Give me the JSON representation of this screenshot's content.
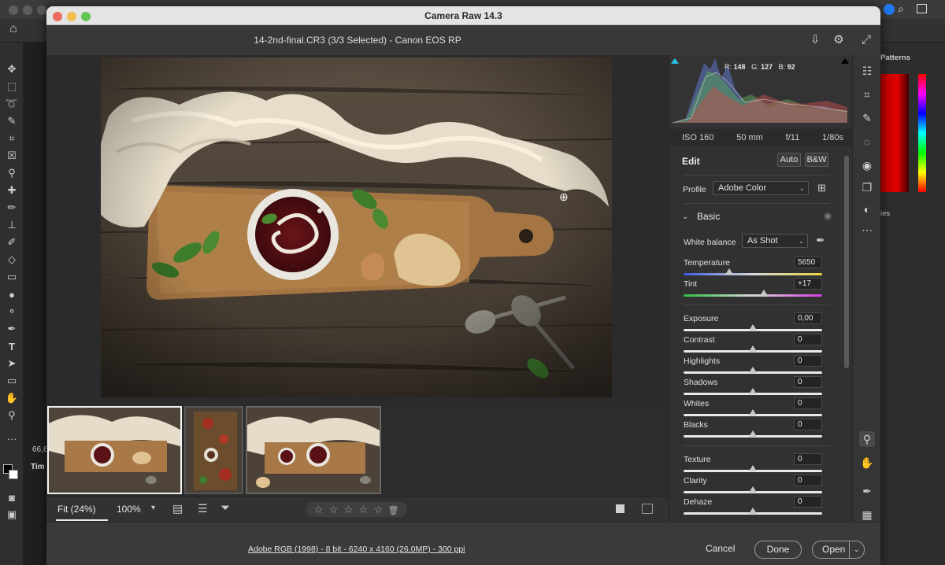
{
  "ps": {
    "panel_tabs": {
      "patterns": "Patterns",
      "properties_partial": "ies"
    },
    "left_strip": {
      "zoom_partial": "66,6",
      "timeline_partial": "Tim"
    }
  },
  "window": {
    "title": "Camera Raw 14.3",
    "file_info": "14-2nd-final.CR3 (3/3 Selected)  -  Canon EOS RP"
  },
  "histogram": {
    "r_label": "R:",
    "r": "148",
    "g_label": "G:",
    "g": "127",
    "b_label": "B:",
    "b": "92"
  },
  "camera": {
    "iso": "ISO 160",
    "focal": "50 mm",
    "aperture": "f/11",
    "shutter": "1/80s"
  },
  "edit": {
    "title": "Edit",
    "auto": "Auto",
    "bw": "B&W",
    "profile_label": "Profile",
    "profile_value": "Adobe Color",
    "basic_title": "Basic",
    "wb_label": "White balance",
    "wb_value": "As Shot",
    "sliders": [
      {
        "label": "Temperature",
        "value": "5650",
        "level": 0.33
      },
      {
        "label": "Tint",
        "value": "+17",
        "level": 0.58
      },
      {
        "label": "Exposure",
        "value": "0,00",
        "level": 0.5
      },
      {
        "label": "Contrast",
        "value": "0",
        "level": 0.5
      },
      {
        "label": "Highlights",
        "value": "0",
        "level": 0.5
      },
      {
        "label": "Shadows",
        "value": "0",
        "level": 0.5
      },
      {
        "label": "Whites",
        "value": "0",
        "level": 0.5
      },
      {
        "label": "Blacks",
        "value": "0",
        "level": 0.5
      },
      {
        "label": "Texture",
        "value": "0",
        "level": 0.5
      },
      {
        "label": "Clarity",
        "value": "0",
        "level": 0.5
      },
      {
        "label": "Dehaze",
        "value": "0",
        "level": 0.5
      }
    ]
  },
  "bottom": {
    "fit": "Fit (24%)",
    "zoom": "100%",
    "stars": [
      "☆",
      "☆",
      "☆",
      "☆",
      "☆"
    ]
  },
  "footer": {
    "workflow": "Adobe RGB (1998) - 8 bit - 6240 x 4160 (26,0MP) - 300 ppi",
    "cancel": "Cancel",
    "done": "Done",
    "open": "Open"
  },
  "colors": {
    "accent_cyan": "#27c2e8",
    "mac_red": "#ed6a5e",
    "mac_yellow": "#f5bf4f",
    "mac_green": "#61c554"
  }
}
